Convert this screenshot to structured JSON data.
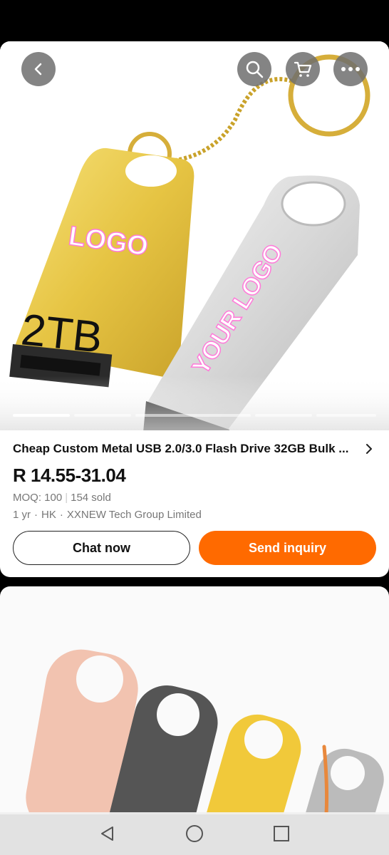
{
  "product": {
    "title": "Cheap Custom Metal USB 2.0/3.0 Flash Drive 32GB Bulk ...",
    "price": "R 14.55-31.04",
    "moq": "MOQ: 100",
    "sold": "154 sold",
    "years": "1 yr",
    "region": "HK",
    "supplier": "XXNEW Tech Group Limited"
  },
  "image_text": {
    "logo": "LOGO",
    "capacity": "2TB",
    "your_logo": "YOUR LOGO"
  },
  "actions": {
    "chat_label": "Chat now",
    "inquiry_label": "Send inquiry"
  },
  "gallery": {
    "slide_count": 5,
    "active_index": 0
  },
  "colors": {
    "accent": "#ff6a00",
    "text": "#111111",
    "muted": "#777777"
  },
  "icons": [
    "back-icon",
    "search-icon",
    "cart-icon",
    "more-icon",
    "chevron-right-icon",
    "nav-back-icon",
    "nav-home-icon",
    "nav-recents-icon"
  ]
}
